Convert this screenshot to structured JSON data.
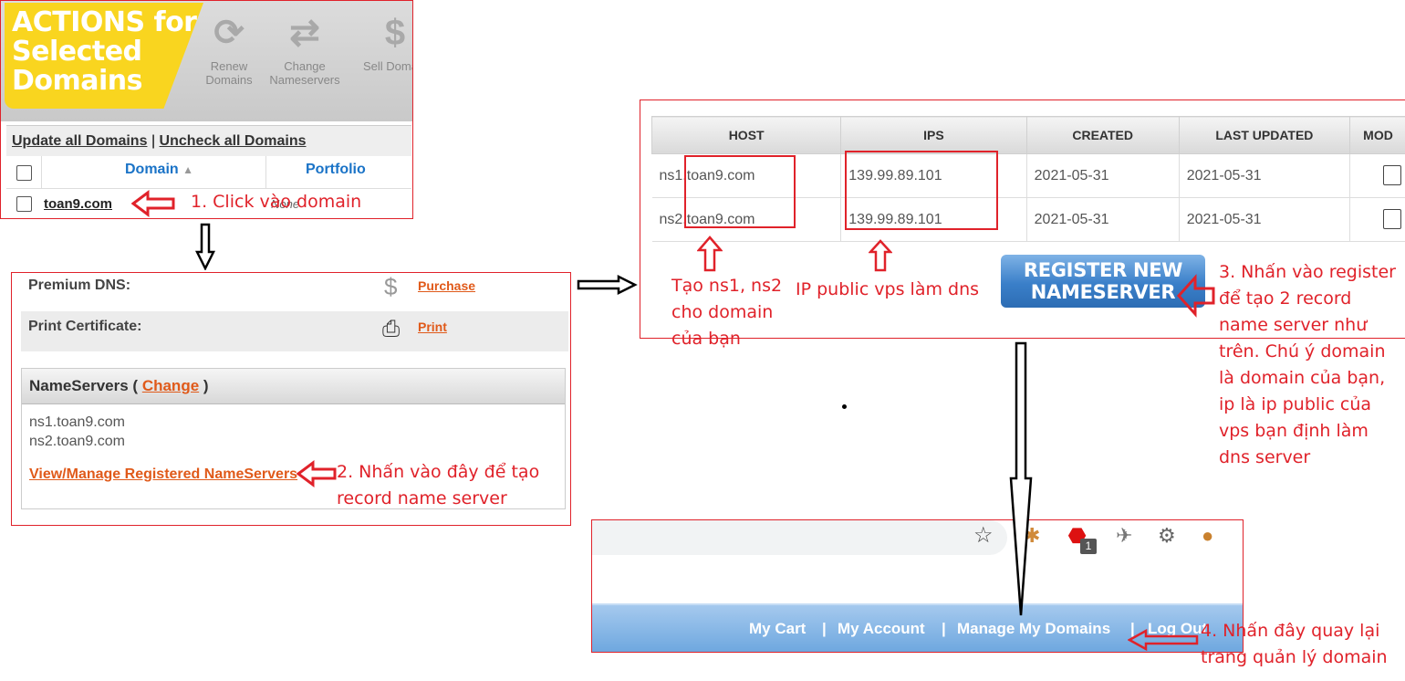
{
  "panel1": {
    "banner_title": "ACTIONS for Selected Domains",
    "tools": [
      {
        "label": "Renew Domains",
        "icon": "renew-icon"
      },
      {
        "label": "Change Nameservers",
        "icon": "swap-arrows-icon"
      },
      {
        "label": "Sell Domain",
        "icon": "dollar-icon"
      }
    ],
    "update_all": "Update all Domains",
    "separator": "|",
    "uncheck_all": "Uncheck all Domains",
    "col_domain": "Domain",
    "col_portfolio": "Portfolio",
    "domain_row": "toan9.com",
    "portfolio_value": "None"
  },
  "panel2": {
    "premium_dns_label": "Premium DNS:",
    "purchase_link": "Purchase",
    "print_cert_label": "Print Certificate:",
    "print_link": "Print",
    "nameservers_title": "NameServers (",
    "change_link": "Change",
    "nameservers_close": ")",
    "ns1": "ns1.toan9.com",
    "ns2": "ns2.toan9.com",
    "manage_link": "View/Manage Registered NameServers"
  },
  "panel3": {
    "headers": [
      "HOST",
      "IPS",
      "CREATED",
      "LAST UPDATED",
      "MOD"
    ],
    "rows": [
      {
        "host": "ns1.toan9.com",
        "ip": "139.99.89.101",
        "created": "2021-05-31",
        "updated": "2021-05-31"
      },
      {
        "host": "ns2.toan9.com",
        "ip": "139.99.89.101",
        "created": "2021-05-31",
        "updated": "2021-05-31"
      }
    ],
    "register_button": "REGISTER NEW NAMESERVER"
  },
  "panel4": {
    "nav": [
      "My Cart",
      "|",
      "My Account",
      "|",
      "Manage My Domains",
      "|",
      "Log Out"
    ],
    "badge": "1"
  },
  "annotations": {
    "step1": "1. Click vào domain",
    "step2": "2. Nhấn vào đây để tạo record name server",
    "step3": "3. Nhấn vào register để tạo 2 record name server như trên. Chú ý domain là domain của bạn, ip là ip public của vps bạn định làm dns server",
    "step4": "4. Nhấn đây quay lại trang quản lý domain",
    "note_ns": "Tạo ns1, ns2 cho domain của bạn",
    "note_ip": "IP public vps làm dns"
  },
  "colors": {
    "annotation_red": "#e0222a",
    "link_orange": "#e05a1a",
    "banner_yellow": "#f9d51f",
    "nav_blue": "#6aa5de"
  }
}
